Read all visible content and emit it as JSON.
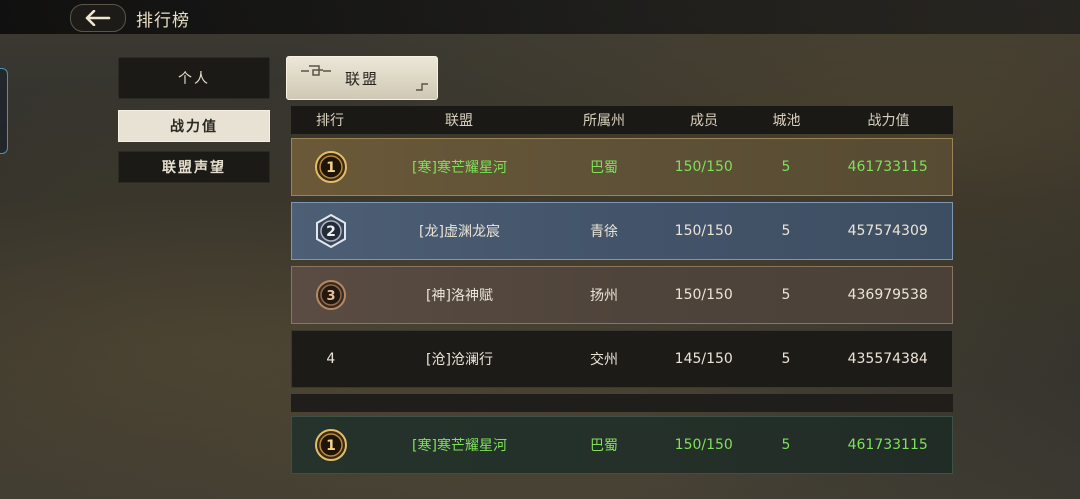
{
  "header": {
    "title": "排行榜"
  },
  "sidebar": {
    "personal_label": "个人",
    "items": [
      {
        "label": "战力值",
        "active": true
      },
      {
        "label": "联盟声望",
        "active": false
      }
    ]
  },
  "tabs": {
    "alliance_label": "联盟"
  },
  "table": {
    "columns": [
      "排行",
      "联盟",
      "所属州",
      "成员",
      "城池",
      "战力值"
    ],
    "rows": [
      {
        "rank": "1",
        "name": "[寒]寒芒耀星河",
        "state": "巴蜀",
        "members": "150/150",
        "cities": "5",
        "power": "461733115",
        "medal": "gold"
      },
      {
        "rank": "2",
        "name": "[龙]虚渊龙宸",
        "state": "青徐",
        "members": "150/150",
        "cities": "5",
        "power": "457574309",
        "medal": "silver"
      },
      {
        "rank": "3",
        "name": "[神]洛神赋",
        "state": "扬州",
        "members": "150/150",
        "cities": "5",
        "power": "436979538",
        "medal": "bronze"
      },
      {
        "rank": "4",
        "name": "[沧]沧澜行",
        "state": "交州",
        "members": "145/150",
        "cities": "5",
        "power": "435574384",
        "medal": "none"
      }
    ],
    "my_alliance": {
      "rank": "1",
      "name": "[寒]寒芒耀星河",
      "state": "巴蜀",
      "members": "150/150",
      "cities": "5",
      "power": "461733115",
      "medal": "gold"
    }
  },
  "colors": {
    "highlight_green": "#7fe05b",
    "gold": "#d8b060",
    "silver": "#c9d4e0",
    "bronze": "#a07a55"
  },
  "icons": {
    "back": "back-arrow-icon",
    "medal_1": "gold-medal-icon",
    "medal_2": "silver-medal-icon",
    "medal_3": "bronze-medal-icon"
  }
}
